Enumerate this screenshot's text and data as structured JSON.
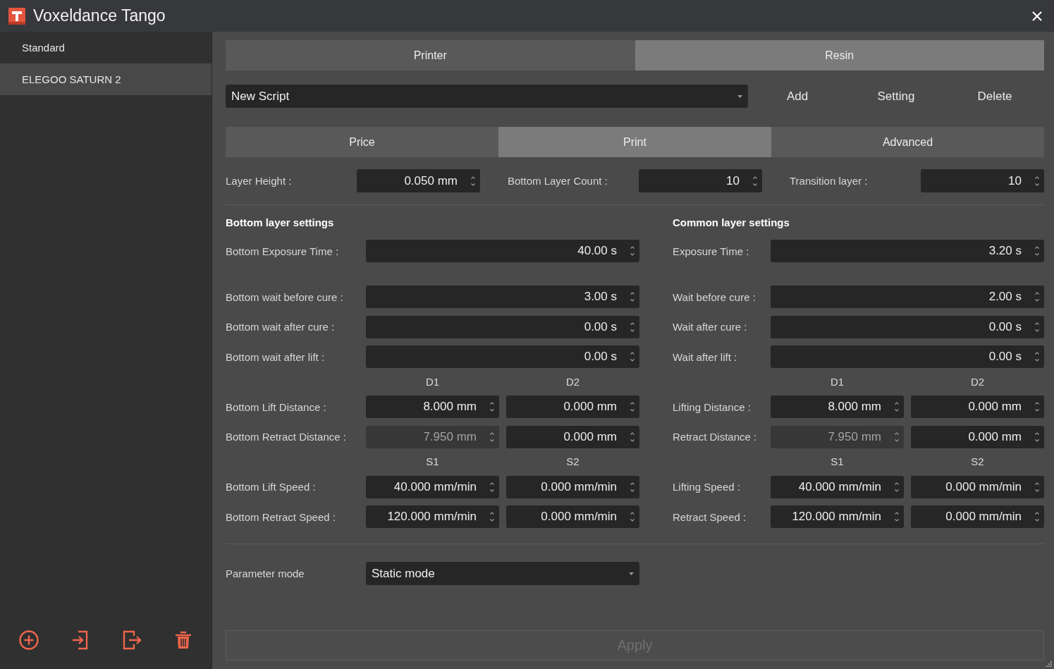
{
  "window": {
    "title": "Voxeldance Tango"
  },
  "sidebar": {
    "items": [
      {
        "label": "Standard",
        "selected": false
      },
      {
        "label": "ELEGOO SATURN 2",
        "selected": true
      }
    ]
  },
  "main_tabs": [
    {
      "label": "Printer",
      "selected": false
    },
    {
      "label": "Resin",
      "selected": true
    }
  ],
  "script_bar": {
    "value": "New Script",
    "actions": [
      {
        "label": "Add"
      },
      {
        "label": "Setting"
      },
      {
        "label": "Delete"
      }
    ]
  },
  "section_tabs": [
    {
      "label": "Price",
      "selected": false
    },
    {
      "label": "Print",
      "selected": true
    },
    {
      "label": "Advanced",
      "selected": false
    }
  ],
  "layer_fields": [
    {
      "label": "Layer Height :",
      "value": "0.050 mm"
    },
    {
      "label": "Bottom Layer Count :",
      "value": "10"
    },
    {
      "label": "Transition layer :",
      "value": "10"
    }
  ],
  "settings": [
    {
      "title": "Bottom layer settings",
      "groups": [
        {
          "rows": [
            {
              "label": "Bottom Exposure Time :",
              "fields": [
                {
                  "value": "40.00 s",
                  "disabled": false
                }
              ]
            }
          ]
        },
        {
          "rows": [
            {
              "label": "Bottom wait before cure :",
              "fields": [
                {
                  "value": "3.00 s",
                  "disabled": false
                }
              ]
            },
            {
              "label": "Bottom wait after cure :",
              "fields": [
                {
                  "value": "0.00 s",
                  "disabled": false
                }
              ]
            },
            {
              "label": "Bottom wait after lift :",
              "fields": [
                {
                  "value": "0.00 s",
                  "disabled": false
                }
              ]
            }
          ]
        },
        {
          "headers": [
            "D1",
            "D2"
          ],
          "rows": [
            {
              "label": "Bottom Lift Distance :",
              "fields": [
                {
                  "value": "8.000 mm",
                  "disabled": false
                },
                {
                  "value": "0.000 mm",
                  "disabled": false
                }
              ]
            },
            {
              "label": "Bottom Retract Distance :",
              "fields": [
                {
                  "value": "7.950 mm",
                  "disabled": true
                },
                {
                  "value": "0.000 mm",
                  "disabled": false
                }
              ]
            }
          ]
        },
        {
          "headers": [
            "S1",
            "S2"
          ],
          "rows": [
            {
              "label": "Bottom Lift Speed :",
              "fields": [
                {
                  "value": "40.000 mm/min",
                  "disabled": false
                },
                {
                  "value": "0.000 mm/min",
                  "disabled": false
                }
              ]
            },
            {
              "label": "Bottom Retract Speed :",
              "fields": [
                {
                  "value": "120.000 mm/min",
                  "disabled": false
                },
                {
                  "value": "0.000 mm/min",
                  "disabled": false
                }
              ]
            }
          ]
        }
      ]
    },
    {
      "title": "Common layer settings",
      "groups": [
        {
          "rows": [
            {
              "label": "Exposure Time :",
              "fields": [
                {
                  "value": "3.20 s",
                  "disabled": false
                }
              ]
            }
          ]
        },
        {
          "rows": [
            {
              "label": "Wait before cure :",
              "fields": [
                {
                  "value": "2.00 s",
                  "disabled": false
                }
              ]
            },
            {
              "label": "Wait after cure :",
              "fields": [
                {
                  "value": "0.00 s",
                  "disabled": false
                }
              ]
            },
            {
              "label": "Wait after lift :",
              "fields": [
                {
                  "value": "0.00 s",
                  "disabled": false
                }
              ]
            }
          ]
        },
        {
          "headers": [
            "D1",
            "D2"
          ],
          "rows": [
            {
              "label": "Lifting Distance :",
              "fields": [
                {
                  "value": "8.000 mm",
                  "disabled": false
                },
                {
                  "value": "0.000 mm",
                  "disabled": false
                }
              ]
            },
            {
              "label": "Retract Distance :",
              "fields": [
                {
                  "value": "7.950 mm",
                  "disabled": true
                },
                {
                  "value": "0.000 mm",
                  "disabled": false
                }
              ]
            }
          ]
        },
        {
          "headers": [
            "S1",
            "S2"
          ],
          "rows": [
            {
              "label": "Lifting Speed :",
              "fields": [
                {
                  "value": "40.000 mm/min",
                  "disabled": false
                },
                {
                  "value": "0.000 mm/min",
                  "disabled": false
                }
              ]
            },
            {
              "label": "Retract Speed :",
              "fields": [
                {
                  "value": "120.000 mm/min",
                  "disabled": false
                },
                {
                  "value": "0.000 mm/min",
                  "disabled": false
                }
              ]
            }
          ]
        }
      ]
    }
  ],
  "parameter_mode": {
    "label": "Parameter mode",
    "value": "Static mode"
  },
  "apply_button": {
    "label": "Apply",
    "disabled": true
  }
}
